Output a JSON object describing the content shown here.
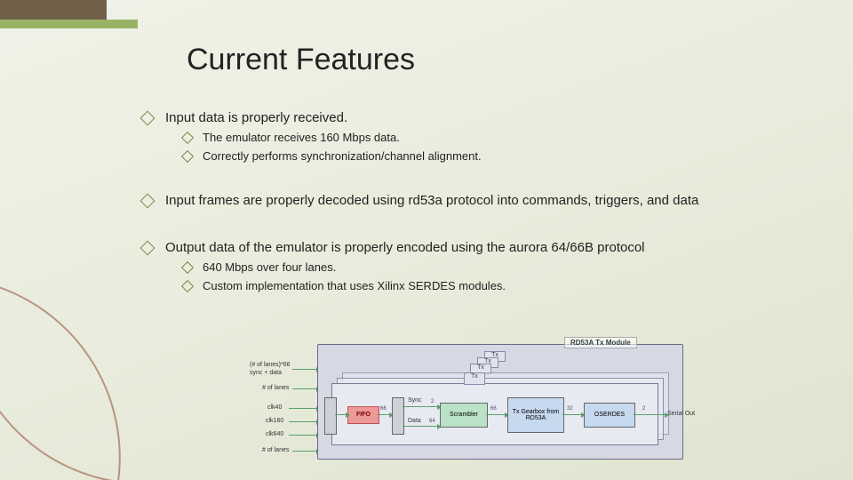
{
  "title": "Current Features",
  "bullets": {
    "b1": "Input data is properly received.",
    "b1a": "The emulator receives 160 Mbps data.",
    "b1b": "Correctly performs synchronization/channel alignment.",
    "b2": "Input frames are properly decoded using rd53a protocol into commands, triggers, and data",
    "b3": "Output data of the emulator is properly encoded using the aurora 64/66B protocol",
    "b3a": "640 Mbps over four lanes.",
    "b3b": "Custom implementation that uses Xilinx SERDES modules."
  },
  "diagram": {
    "module_title": "RD53A Tx Module",
    "tabs": [
      "Tx",
      "Tx",
      "Tx",
      "Tx"
    ],
    "left_labels": {
      "l1": "(# of lanes)*66",
      "l1b": "sync + data",
      "l2": "# of lanes",
      "l3": "clk40",
      "l4": "clk160",
      "l5": "clk640",
      "l6": "# of lanes"
    },
    "lane": {
      "sync_label": "Sync",
      "data_label": "Data",
      "fifo": "FIFO",
      "n66": "66",
      "n2a": "2",
      "n64": "64",
      "scrambler": "Scrambler",
      "n66b": "66",
      "gearbox": "Tx Gearbox from RD53A",
      "n32": "32",
      "oserdes": "OSERDES",
      "n2b": "2",
      "serial_out": "Serial Out"
    }
  }
}
